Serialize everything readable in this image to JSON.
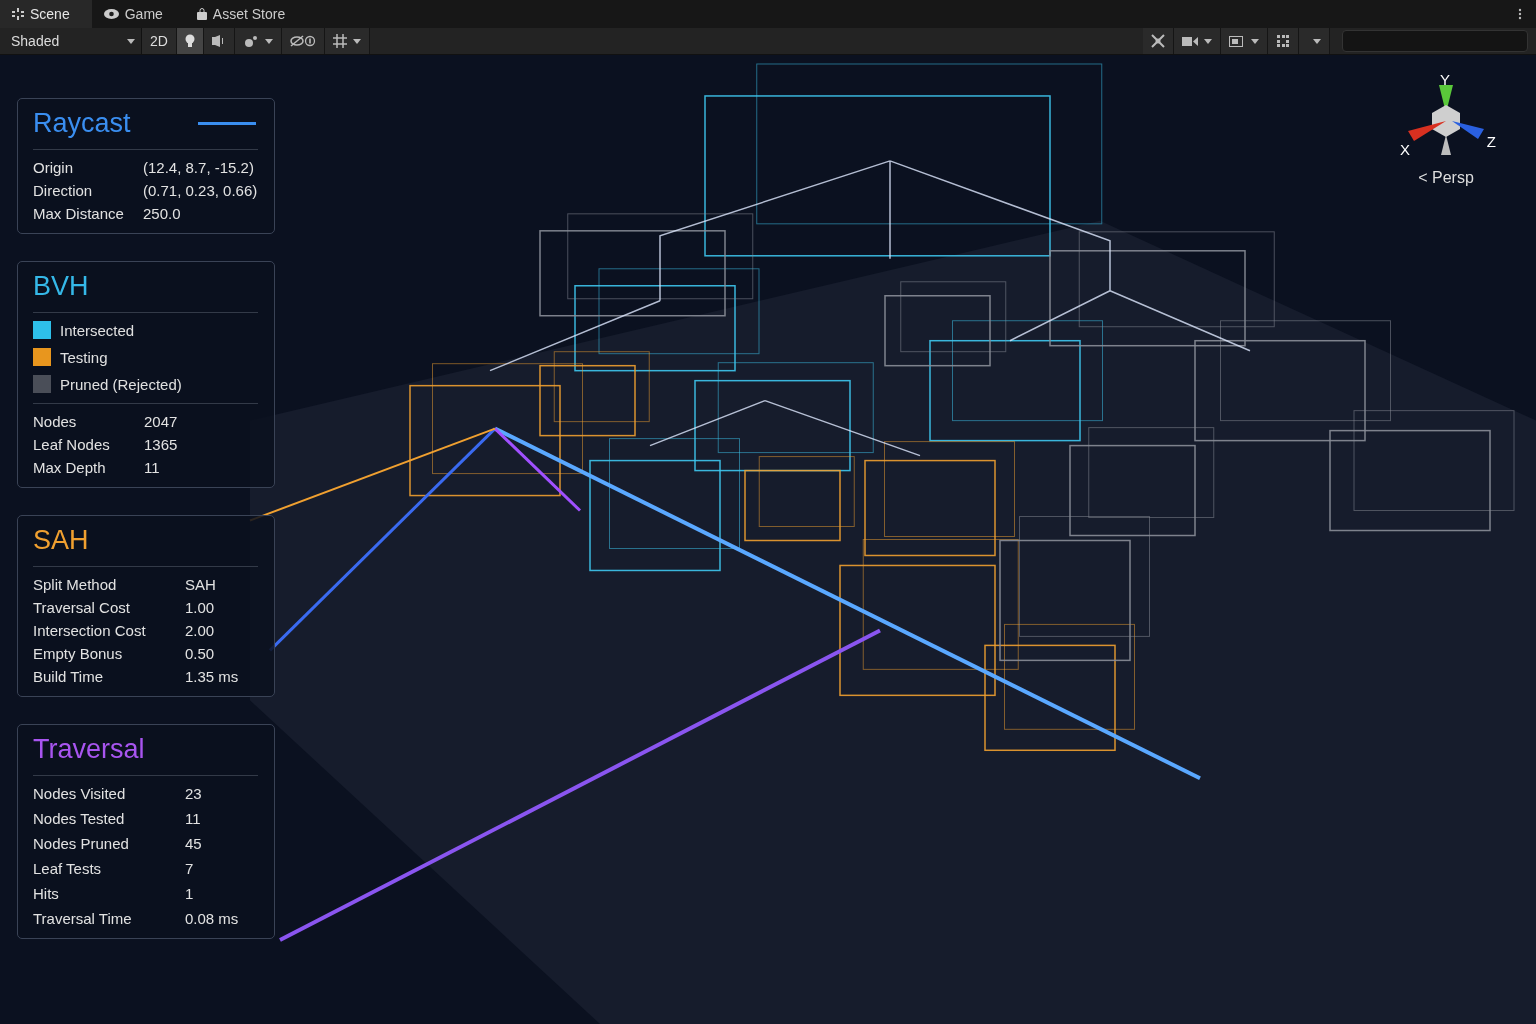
{
  "tabs": [
    {
      "label": "Scene",
      "selected": true
    },
    {
      "label": "Game",
      "selected": false
    },
    {
      "label": "Asset Store",
      "selected": false
    }
  ],
  "toolbar": {
    "shading_mode": "Shaded",
    "mode_2d": "2D",
    "lighting_on": true
  },
  "gizmo": {
    "y": "Y",
    "x": "X",
    "z": "Z",
    "projection": "< Persp"
  },
  "panels": [
    {
      "title": "Raycast",
      "color": "#3a8ef0",
      "accent_line": true,
      "rows": [
        {
          "label": "Origin",
          "value": "(12.4, 8.7, -15.2)"
        },
        {
          "label": "Direction",
          "value": "(0.71, 0.23, 0.66)"
        },
        {
          "label": "Max Distance",
          "value": "250.0"
        }
      ]
    },
    {
      "title": "BVH",
      "color": "#35b8e8",
      "accent_line": false,
      "legend": [
        {
          "label": "Intersected",
          "color": "#2ec0ea"
        },
        {
          "label": "Testing",
          "color": "#e8961e"
        },
        {
          "label": "Pruned (Rejected)",
          "color": "#4a4e58"
        }
      ],
      "rows": [
        {
          "label": "Nodes",
          "value": "2047"
        },
        {
          "label": "Leaf Nodes",
          "value": "1365"
        },
        {
          "label": "Max Depth",
          "value": "11"
        }
      ]
    },
    {
      "title": "SAH",
      "color": "#f0a030",
      "accent_line": false,
      "rows": [
        {
          "label": "Split Method",
          "value": "SAH"
        },
        {
          "label": "Traversal Cost",
          "value": "1.00"
        },
        {
          "label": "Intersection Cost",
          "value": "2.00"
        },
        {
          "label": "Empty Bonus",
          "value": "0.50"
        },
        {
          "label": "Build Time",
          "value": "1.35 ms"
        }
      ]
    },
    {
      "title": "Traversal",
      "color": "#a855f0",
      "accent_line": false,
      "rows": [
        {
          "label": "Nodes Visited",
          "value": "23"
        },
        {
          "label": "Nodes Tested",
          "value": "11"
        },
        {
          "label": "Nodes Pruned",
          "value": "45"
        },
        {
          "label": "Leaf Tests",
          "value": "7"
        },
        {
          "label": "Hits",
          "value": "1"
        },
        {
          "label": "Traversal Time",
          "value": "0.08 ms"
        }
      ]
    }
  ]
}
